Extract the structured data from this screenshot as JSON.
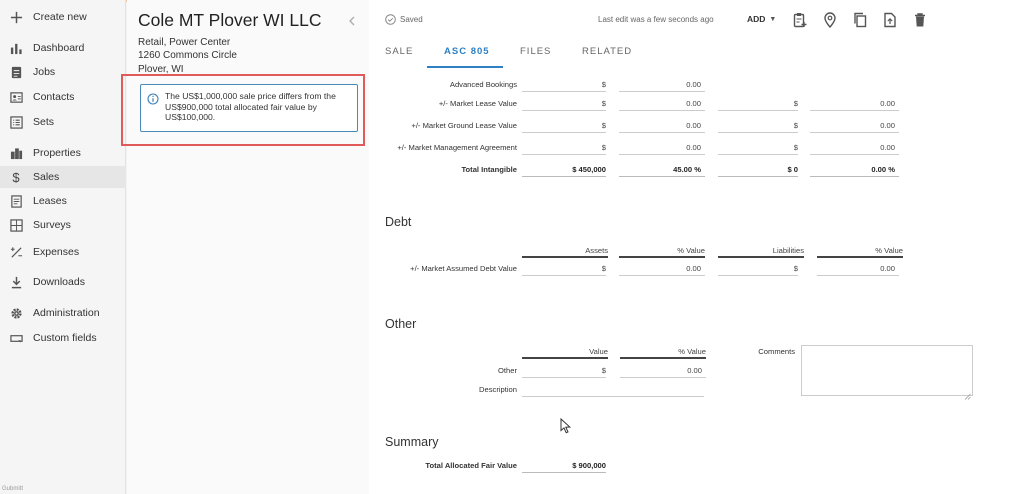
{
  "sidebar": {
    "items": [
      {
        "label": "Create new",
        "icon": "plus-icon"
      },
      {
        "label": "Dashboard",
        "icon": "bar-chart-icon"
      },
      {
        "label": "Jobs",
        "icon": "clipboard-icon"
      },
      {
        "label": "Contacts",
        "icon": "contact-card-icon"
      },
      {
        "label": "Sets",
        "icon": "list-icon"
      },
      {
        "label": "Properties",
        "icon": "building-icon"
      },
      {
        "label": "Sales",
        "icon": "dollar-icon"
      },
      {
        "label": "Leases",
        "icon": "document-icon"
      },
      {
        "label": "Surveys",
        "icon": "grid-icon"
      },
      {
        "label": "Expenses",
        "icon": "percent-icon"
      },
      {
        "label": "Downloads",
        "icon": "download-icon"
      },
      {
        "label": "Administration",
        "icon": "gear-icon"
      },
      {
        "label": "Custom fields",
        "icon": "input-field-icon"
      }
    ],
    "footer": "Gubmitt"
  },
  "property": {
    "title": "Cole MT Plover WI LLC",
    "type": "Retail, Power Center",
    "address": "1260 Commons Circle",
    "city": "Plover, WI",
    "alert": "The US$1,000,000 sale price differs from the US$900,000 total allocated fair value by US$100,000."
  },
  "toolbar": {
    "saved": "Saved",
    "last_edit": "Last edit was a few seconds ago",
    "add_label": "ADD"
  },
  "tabs": [
    {
      "label": "SALE",
      "active": false
    },
    {
      "label": "ASC 805",
      "active": true
    },
    {
      "label": "FILES",
      "active": false
    },
    {
      "label": "RELATED",
      "active": false
    }
  ],
  "intangible": {
    "rows": [
      {
        "label": "Advanced Bookings",
        "a_cur": "$",
        "a_val": "0.00",
        "l_cur": "",
        "l_val": ""
      },
      {
        "label": "+/- Market Lease Value",
        "a_cur": "$",
        "a_val": "0.00",
        "l_cur": "$",
        "l_val": "0.00"
      },
      {
        "label": "+/- Market Ground Lease Value",
        "a_cur": "$",
        "a_val": "0.00",
        "l_cur": "$",
        "l_val": "0.00"
      },
      {
        "label": "+/- Market Management Agreement",
        "a_cur": "$",
        "a_val": "0.00",
        "l_cur": "$",
        "l_val": "0.00"
      }
    ],
    "total": {
      "label": "Total Intangible",
      "assets": "$ 450,000",
      "assets_pct": "45.00 %",
      "liabilities": "$ 0",
      "liabilities_pct": "0.00 %"
    }
  },
  "debt": {
    "title": "Debt",
    "headers": {
      "assets": "Assets",
      "assets_pct": "% Value",
      "liabilities": "Liabilities",
      "liabilities_pct": "% Value"
    },
    "row": {
      "label": "+/- Market Assumed Debt Value",
      "a_cur": "$",
      "a_val": "0.00",
      "l_cur": "$",
      "l_val": "0.00"
    }
  },
  "other": {
    "title": "Other",
    "headers": {
      "value": "Value",
      "pct": "% Value"
    },
    "row": {
      "label": "Other",
      "cur": "$",
      "val": "0.00"
    },
    "description_label": "Description",
    "comments_label": "Comments"
  },
  "summary": {
    "title": "Summary",
    "label": "Total Allocated Fair Value",
    "value": "$ 900,000"
  }
}
